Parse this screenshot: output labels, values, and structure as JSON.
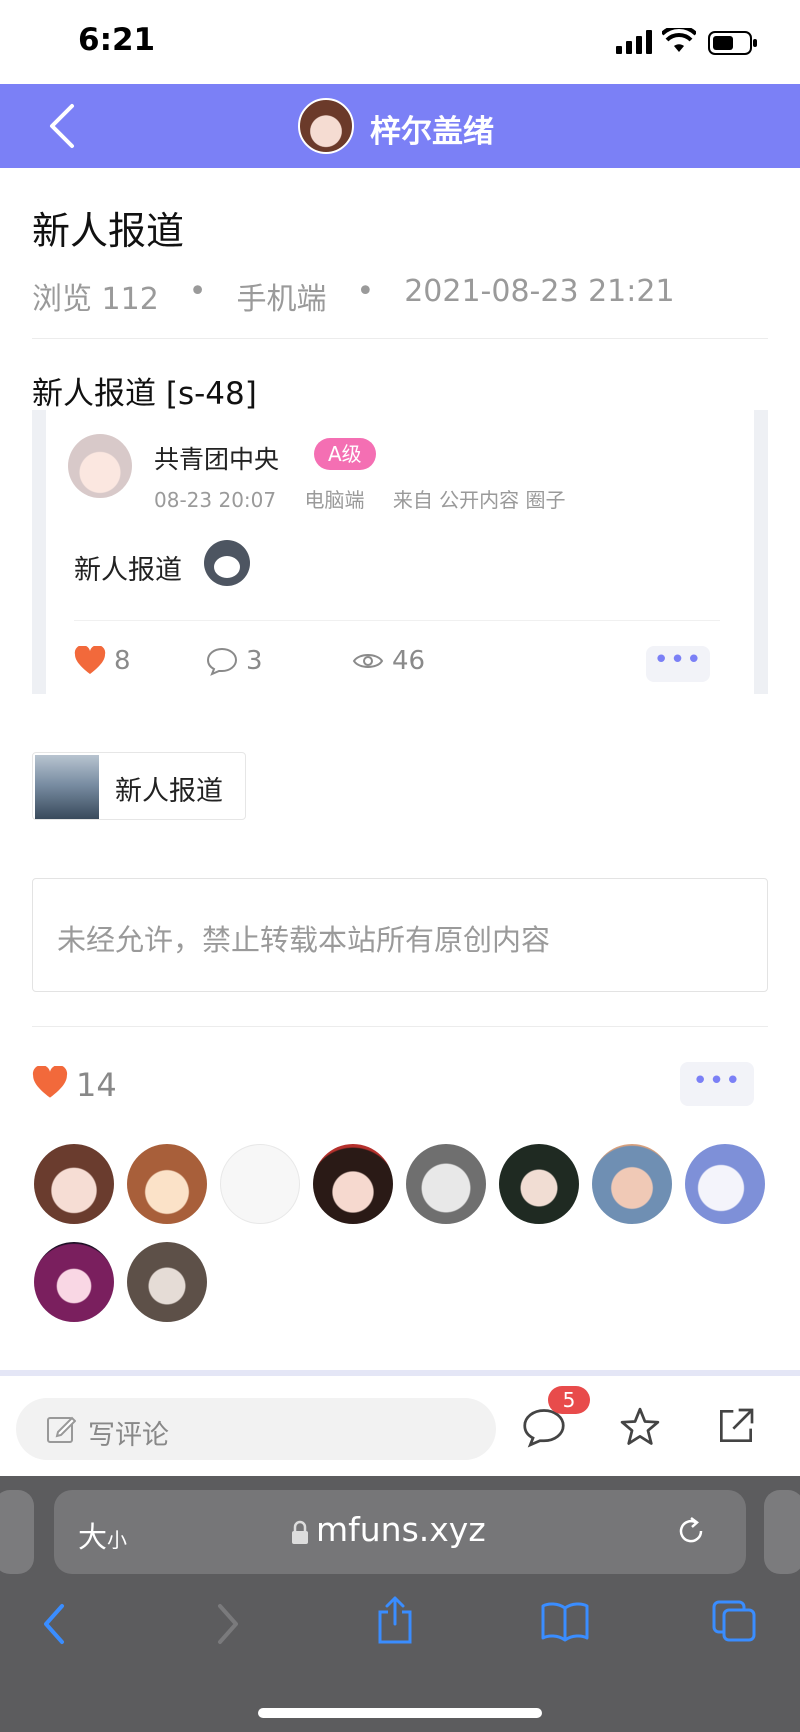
{
  "status": {
    "time": "6:21"
  },
  "header": {
    "title": "梓尔盖绪"
  },
  "post": {
    "title": "新人报道",
    "views": "浏览 112",
    "dot": "•",
    "device": "手机端",
    "datetime": "2021-08-23 21:21",
    "content_heading": "新人报道 [s-48]"
  },
  "embed": {
    "user": "共青团中央",
    "level": "A级",
    "time": "08-23 20:07",
    "device": "电脑端",
    "source": "来自 公开内容 圈子",
    "text": "新人报道",
    "likes": "8",
    "comments": "3",
    "views": "46",
    "more": "•••"
  },
  "link_chip": {
    "label": "新人报道"
  },
  "notice": {
    "text": "未经允许，禁止转载本站所有原创内容"
  },
  "likes": {
    "count": "14",
    "more": "•••"
  },
  "comment_bar": {
    "placeholder": "写评论",
    "badge": "5"
  },
  "safari": {
    "aa_big": "大",
    "aa_small": "小",
    "url": "mfuns.xyz"
  },
  "colors": {
    "accent": "#7b80f6",
    "like": "#f2693b",
    "badge": "#f46fb3"
  }
}
